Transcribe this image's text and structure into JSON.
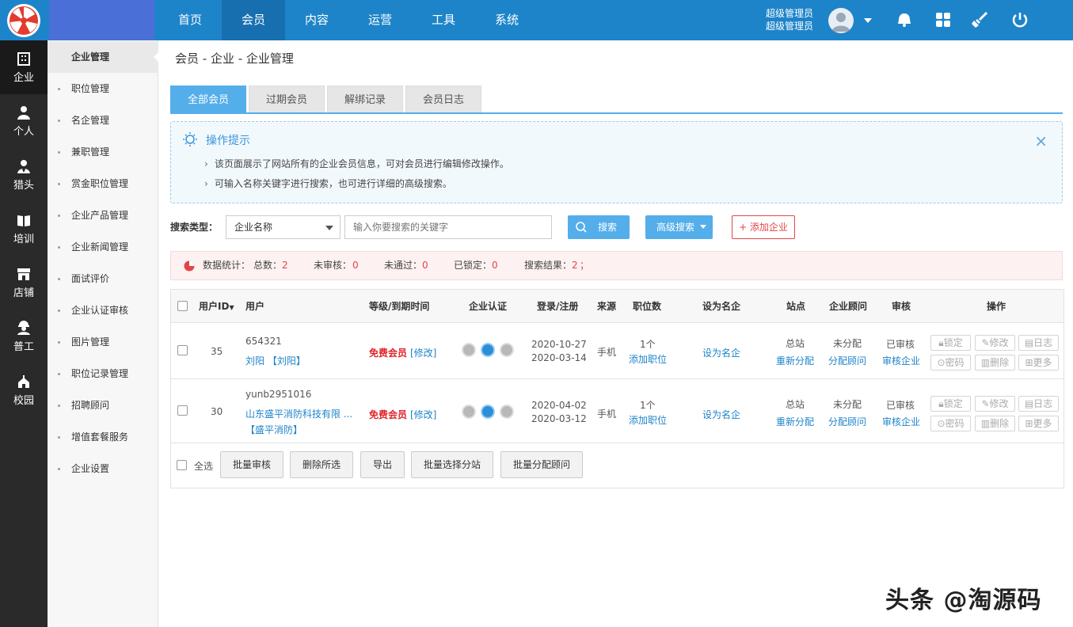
{
  "top": {
    "nav": [
      "首页",
      "会员",
      "内容",
      "运营",
      "工具",
      "系统"
    ],
    "active_nav": "会员",
    "admin_line1": "超级管理员",
    "admin_line2": "超级管理员"
  },
  "rail": [
    "企业",
    "个人",
    "猎头",
    "培训",
    "店铺",
    "普工",
    "校园"
  ],
  "submenu": [
    "企业管理",
    "职位管理",
    "名企管理",
    "兼职管理",
    "赏金职位管理",
    "企业产品管理",
    "企业新闻管理",
    "面试评价",
    "企业认证审核",
    "图片管理",
    "职位记录管理",
    "招聘顾问",
    "增值套餐服务",
    "企业设置"
  ],
  "breadcrumb": "会员 - 企业 - 企业管理",
  "tabs": [
    "全部会员",
    "过期会员",
    "解绑记录",
    "会员日志"
  ],
  "tip": {
    "title": "操作提示",
    "line1": "该页面展示了网站所有的企业会员信息，可对会员进行编辑修改操作。",
    "line2": "可输入名称关键字进行搜索，也可进行详细的高级搜索。"
  },
  "search": {
    "label": "搜索类型：",
    "type": "企业名称",
    "placeholder": "输入你要搜索的关键字",
    "search_btn": "搜索",
    "advanced_btn": "高级搜索",
    "add_btn": "+ 添加企业"
  },
  "stats": {
    "label": "数据统计：",
    "total_label": "总数：",
    "total": "2",
    "unreviewed_label": "未审核：",
    "unreviewed": "0",
    "rejected_label": "未通过：",
    "rejected": "0",
    "locked_label": "已锁定：",
    "locked": "0",
    "result_label": "搜索结果：",
    "result": "2",
    "end": "；"
  },
  "table": {
    "headers": {
      "uid": "用户ID",
      "user": "用户",
      "level": "等级/到期时间",
      "verify": "企业认证",
      "login": "登录/注册",
      "source": "来源",
      "jobs": "职位数",
      "famous": "设为名企",
      "site": "站点",
      "consultant": "企业顾问",
      "review": "审核",
      "ops": "操作"
    },
    "rows": [
      {
        "id": "35",
        "username": "654321",
        "company": "刘阳",
        "company_suffix": "【刘阳】",
        "company_sub": "",
        "level": "免费会员",
        "level_edit": "[修改]",
        "login": "2020-10-27",
        "register": "2020-03-14",
        "source": "手机",
        "jobs": "1个",
        "add_job": "添加职位",
        "famous": "设为名企",
        "site": "总站",
        "site_action": "重新分配",
        "consultant": "未分配",
        "consultant_action": "分配顾问",
        "review": "已审核",
        "review_action": "审核企业"
      },
      {
        "id": "30",
        "username": "yunb2951016",
        "company": "山东盛平消防科技有限 ...",
        "company_suffix": "",
        "company_sub": "【盛平消防】",
        "level": "免费会员",
        "level_edit": "[修改]",
        "login": "2020-04-02",
        "register": "2020-03-12",
        "source": "手机",
        "jobs": "1个",
        "add_job": "添加职位",
        "famous": "设为名企",
        "site": "总站",
        "site_action": "重新分配",
        "consultant": "未分配",
        "consultant_action": "分配顾问",
        "review": "已审核",
        "review_action": "审核企业"
      }
    ],
    "row_ops": [
      "锁定",
      "修改",
      "日志",
      "密码",
      "删除",
      "更多"
    ]
  },
  "bulk": {
    "select_all": "全选",
    "buttons": [
      "批量审核",
      "删除所选",
      "导出",
      "批量选择分站",
      "批量分配顾问"
    ]
  },
  "watermark": "头条 @淘源码",
  "colors": {
    "primary": "#1e84c9",
    "tab_active": "#54aeea",
    "danger": "#e0464a"
  }
}
